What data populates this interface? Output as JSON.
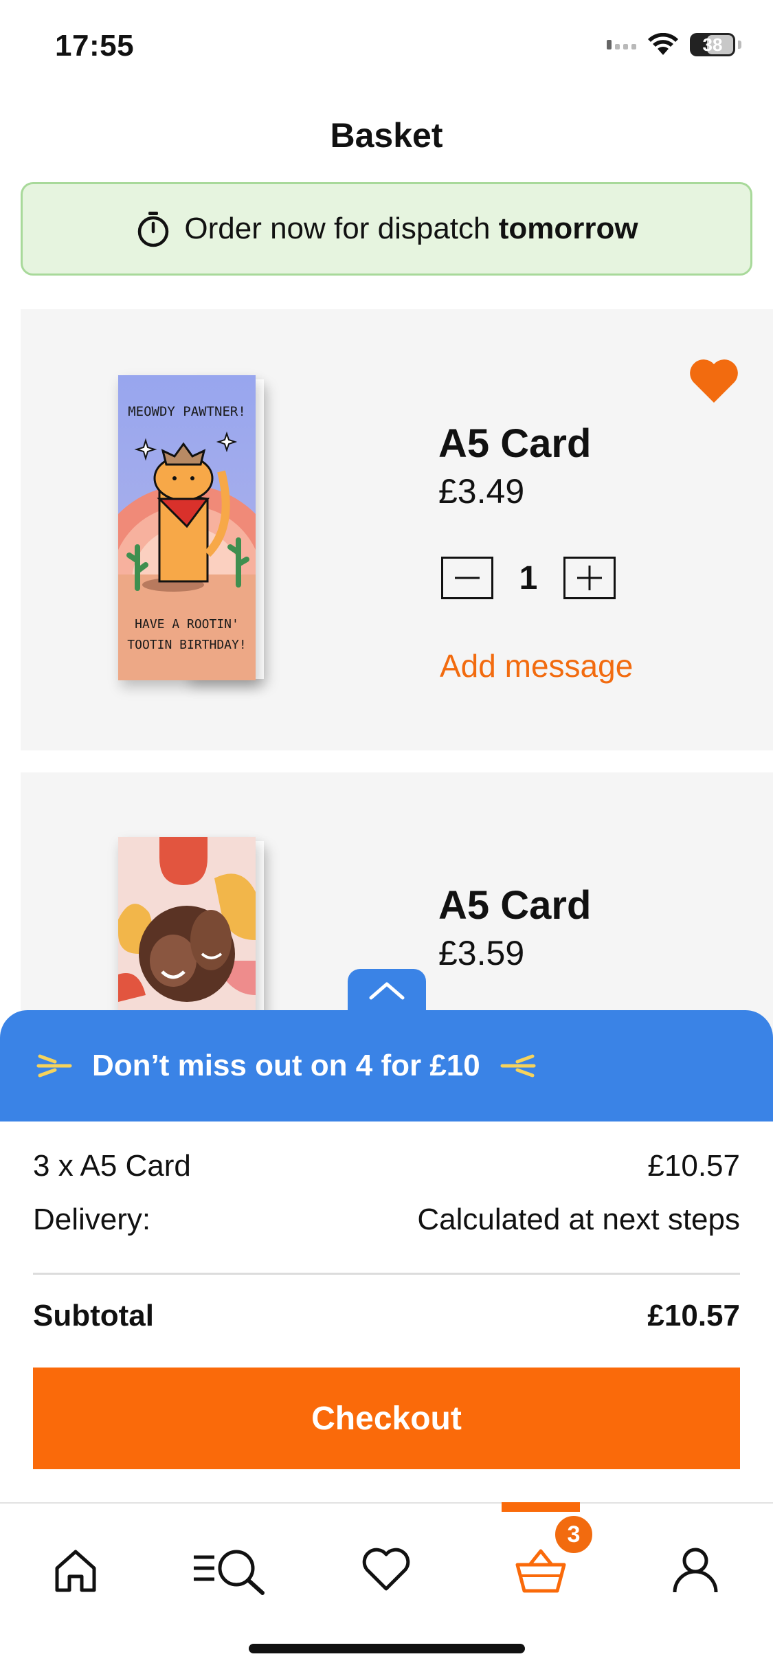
{
  "status": {
    "time": "17:55",
    "battery": "38"
  },
  "header": {
    "title": "Basket"
  },
  "banner": {
    "text": "Order now for dispatch",
    "bold": "tomorrow",
    "icon": "stopwatch-icon"
  },
  "items": [
    {
      "name": "A5 Card",
      "price": "£3.49",
      "quantity": "1",
      "add_message": "Add message",
      "favourited": true,
      "card_text_top": "MEOWDY PAWTNER!",
      "card_text_bottom_1": "HAVE A ROOTIN'",
      "card_text_bottom_2": "TOOTIN BIRTHDAY!"
    },
    {
      "name": "A5 Card",
      "price": "£3.59"
    }
  ],
  "promo": {
    "text": "Don’t miss out on 4 for £10"
  },
  "summary": {
    "items_label": "3 x A5 Card",
    "items_value": "£10.57",
    "delivery_label": "Delivery:",
    "delivery_value": "Calculated at next steps",
    "subtotal_label": "Subtotal",
    "subtotal_value": "£10.57"
  },
  "checkout": {
    "label": "Checkout"
  },
  "tabbar": {
    "basket_count": "3",
    "tabs": [
      "home-icon",
      "search-menu-icon",
      "heart-icon",
      "basket-icon",
      "account-icon"
    ],
    "active": "basket-icon"
  },
  "colors": {
    "accent": "#fa6a0a",
    "promo": "#3a83e6",
    "banner_bg": "#e6f4df",
    "banner_border": "#a8d99a"
  }
}
